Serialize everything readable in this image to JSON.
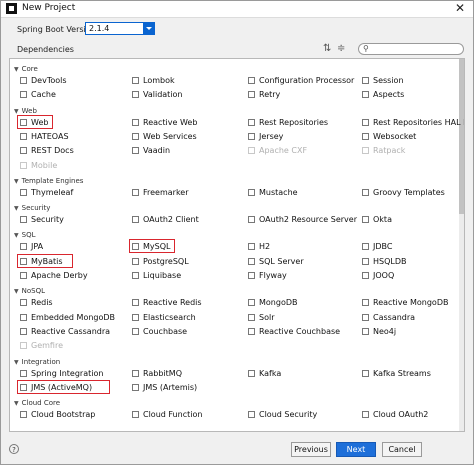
{
  "window": {
    "title": "New Project"
  },
  "boot_version": {
    "label": "Spring Boot Version:",
    "value": "2.1.4"
  },
  "dependencies_label": "Dependencies",
  "icons": [
    "sort-icon",
    "expand-all-icon",
    "search-icon"
  ],
  "categories": [
    {
      "name": "Core",
      "items": [
        {
          "label": "DevTools"
        },
        {
          "label": "Lombok"
        },
        {
          "label": "Configuration Processor"
        },
        {
          "label": "Session"
        },
        {
          "label": "Cache"
        },
        {
          "label": "Validation"
        },
        {
          "label": "Retry"
        },
        {
          "label": "Aspects"
        }
      ]
    },
    {
      "name": "Web",
      "items": [
        {
          "label": "Web",
          "highlight": true
        },
        {
          "label": "Reactive Web"
        },
        {
          "label": "Rest Repositories"
        },
        {
          "label": "Rest Repositories HAL Browse"
        },
        {
          "label": "HATEOAS"
        },
        {
          "label": "Web Services"
        },
        {
          "label": "Jersey"
        },
        {
          "label": "Websocket"
        },
        {
          "label": "REST Docs"
        },
        {
          "label": "Vaadin"
        },
        {
          "label": "Apache CXF",
          "disabled": true
        },
        {
          "label": "Ratpack",
          "disabled": true
        },
        {
          "label": "Mobile",
          "disabled": true
        }
      ]
    },
    {
      "name": "Template Engines",
      "items": [
        {
          "label": "Thymeleaf"
        },
        {
          "label": "Freemarker"
        },
        {
          "label": "Mustache"
        },
        {
          "label": "Groovy Templates"
        }
      ]
    },
    {
      "name": "Security",
      "items": [
        {
          "label": "Security"
        },
        {
          "label": "OAuth2 Client"
        },
        {
          "label": "OAuth2 Resource Server"
        },
        {
          "label": "Okta"
        }
      ]
    },
    {
      "name": "SQL",
      "items": [
        {
          "label": "JPA"
        },
        {
          "label": "MySQL",
          "highlight": true
        },
        {
          "label": "H2"
        },
        {
          "label": "JDBC"
        },
        {
          "label": "MyBatis",
          "highlight": true
        },
        {
          "label": "PostgreSQL"
        },
        {
          "label": "SQL Server"
        },
        {
          "label": "HSQLDB"
        },
        {
          "label": "Apache Derby"
        },
        {
          "label": "Liquibase"
        },
        {
          "label": "Flyway"
        },
        {
          "label": "JOOQ"
        }
      ]
    },
    {
      "name": "NoSQL",
      "items": [
        {
          "label": "Redis"
        },
        {
          "label": "Reactive Redis"
        },
        {
          "label": "MongoDB"
        },
        {
          "label": "Reactive MongoDB"
        },
        {
          "label": "Embedded MongoDB"
        },
        {
          "label": "Elasticsearch"
        },
        {
          "label": "Solr"
        },
        {
          "label": "Cassandra"
        },
        {
          "label": "Reactive Cassandra"
        },
        {
          "label": "Couchbase"
        },
        {
          "label": "Reactive Couchbase"
        },
        {
          "label": "Neo4j"
        },
        {
          "label": "Gemfire",
          "disabled": true
        }
      ]
    },
    {
      "name": "Integration",
      "items": [
        {
          "label": "Spring Integration"
        },
        {
          "label": "RabbitMQ"
        },
        {
          "label": "Kafka"
        },
        {
          "label": "Kafka Streams"
        },
        {
          "label": "JMS (ActiveMQ)",
          "highlight": true
        },
        {
          "label": "JMS (Artemis)"
        }
      ]
    },
    {
      "name": "Cloud Core",
      "items": [
        {
          "label": "Cloud Bootstrap"
        },
        {
          "label": "Cloud Function"
        },
        {
          "label": "Cloud Security"
        },
        {
          "label": "Cloud OAuth2"
        }
      ]
    }
  ],
  "buttons": {
    "previous": "Previous",
    "next": "Next",
    "cancel": "Cancel",
    "help": "?"
  },
  "colors": {
    "accent": "#1e6fd9",
    "highlight": "#d9262e"
  }
}
